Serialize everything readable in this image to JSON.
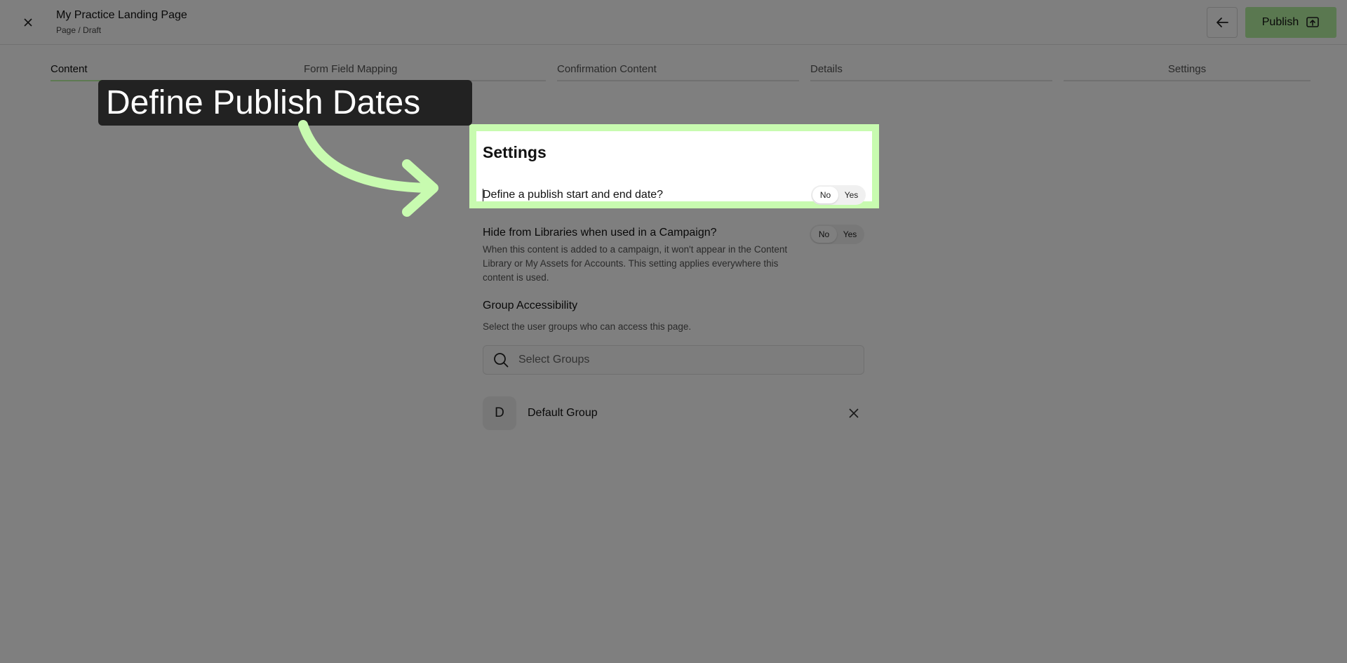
{
  "header": {
    "title": "My Practice Landing Page",
    "subtitle": "Page / Draft",
    "close_icon": "close-icon",
    "back_icon": "arrow-left-icon",
    "publish_label": "Publish",
    "publish_icon": "publish-icon",
    "publish_color": "#b4f0a0"
  },
  "tabs": [
    {
      "label": "Content",
      "active": true
    },
    {
      "label": "Form Field Mapping",
      "active": false
    },
    {
      "label": "Confirmation Content",
      "active": false
    },
    {
      "label": "Details",
      "active": false
    },
    {
      "label": "Settings",
      "active": false
    }
  ],
  "settings": {
    "title": "Settings",
    "publish_dates": {
      "label": "Define a publish start and end date?",
      "toggle": {
        "no": "No",
        "yes": "Yes",
        "selected": "No"
      }
    },
    "hide_libraries": {
      "label": "Hide from Libraries when used in a Campaign?",
      "description": "When this content is added to a campaign, it won't appear in the Content Library or My Assets for Accounts. This setting applies everywhere this content is used.",
      "toggle": {
        "no": "No",
        "yes": "Yes",
        "selected": "No"
      }
    },
    "group_accessibility": {
      "title": "Group Accessibility",
      "description": "Select the user groups who can access this page.",
      "search_placeholder": "Select Groups",
      "groups": [
        {
          "initial": "D",
          "name": "Default Group"
        }
      ]
    }
  },
  "annotation": {
    "text": "Define Publish Dates",
    "highlight_color": "#c8fbb0",
    "background": "#222222"
  }
}
